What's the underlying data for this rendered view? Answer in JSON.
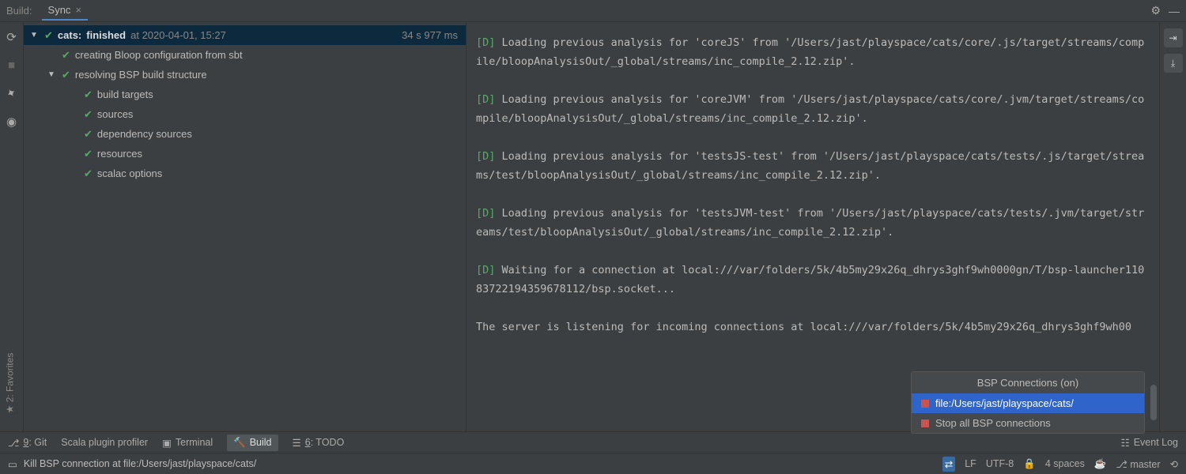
{
  "topbar": {
    "label": "Build:",
    "tab_name": "Sync",
    "gear_icon": "⚙",
    "minimize_icon": "—"
  },
  "gutter": {
    "refresh": "↻",
    "stop": "■",
    "pin": "📌",
    "eye": "👁"
  },
  "tree": {
    "root": {
      "name": "cats:",
      "status": "finished",
      "time": "at 2020-04-01, 15:27",
      "duration": "34 s 977 ms"
    },
    "items": [
      {
        "label": "creating Bloop configuration from sbt",
        "indent": 1,
        "chev": false
      },
      {
        "label": "resolving BSP build structure",
        "indent": 1,
        "chev": true
      },
      {
        "label": "build targets",
        "indent": 2,
        "chev": false
      },
      {
        "label": "sources",
        "indent": 2,
        "chev": false
      },
      {
        "label": "dependency sources",
        "indent": 2,
        "chev": false
      },
      {
        "label": "resources",
        "indent": 2,
        "chev": false
      },
      {
        "label": "scalac options",
        "indent": 2,
        "chev": false
      }
    ]
  },
  "console": {
    "lines": [
      {
        "d": true,
        "text": "Loading previous analysis for 'coreJS' from '/Users/jast/playspace/cats/core/.js/target/streams/compile/bloopAnalysisOut/_global/streams/inc_compile_2.12.zip'."
      },
      {
        "d": true,
        "text": "Loading previous analysis for 'coreJVM' from '/Users/jast/playspace/cats/core/.jvm/target/streams/compile/bloopAnalysisOut/_global/streams/inc_compile_2.12.zip'."
      },
      {
        "d": true,
        "text": "Loading previous analysis for 'testsJS-test' from '/Users/jast/playspace/cats/tests/.js/target/streams/test/bloopAnalysisOut/_global/streams/inc_compile_2.12.zip'."
      },
      {
        "d": true,
        "text": "Loading previous analysis for 'testsJVM-test' from '/Users/jast/playspace/cats/tests/.jvm/target/streams/test/bloopAnalysisOut/_global/streams/inc_compile_2.12.zip'."
      },
      {
        "d": true,
        "text": "Waiting for a connection at local:///var/folders/5k/4b5my29x26q_dhrys3ghf9wh0000gn/T/bsp-launcher11083722194359678112/bsp.socket..."
      },
      {
        "d": false,
        "text": "The server is listening for incoming connections at local:///var/folders/5k/4b5my29x26q_dhrys3ghf9wh00"
      }
    ]
  },
  "popup": {
    "title": "BSP Connections (on)",
    "item1": "file:/Users/jast/playspace/cats/",
    "item2": "Stop all BSP connections"
  },
  "favorites": "★ 2: Favorites",
  "bottombar": {
    "git": "9: Git",
    "profiler": "Scala plugin profiler",
    "terminal": "Terminal",
    "build": "Build",
    "todo": "6: TODO",
    "eventlog": "Event Log"
  },
  "statusbar": {
    "msg": "Kill BSP connection at file:/Users/jast/playspace/cats/",
    "lf": "LF",
    "enc": "UTF-8",
    "indent": "4 spaces",
    "branch": "master"
  }
}
